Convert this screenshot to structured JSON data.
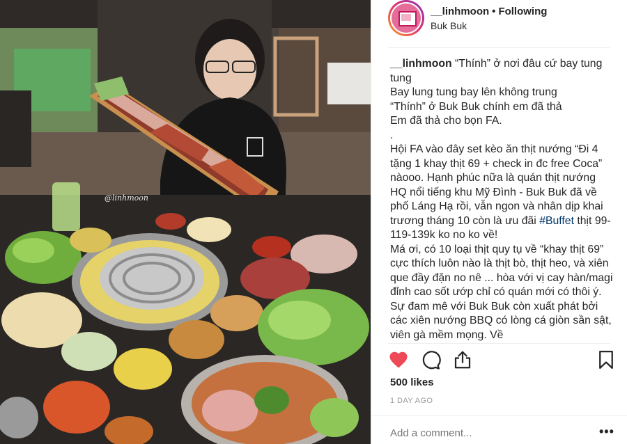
{
  "photo": {
    "alt": "Person seated behind a long wooden board of grilled meats and a table of BBQ side dishes",
    "watermark": "@linhmoon"
  },
  "header": {
    "username": "__linhmoon",
    "separator": "•",
    "follow_status": "Following",
    "location": "Buk Buk"
  },
  "caption": {
    "username": "__linhmoon",
    "lines": [
      "“Thính” ở nơi đâu cứ bay tung tung",
      "Bay lung tung bay lên không trung",
      "“Thính” ở Buk Buk chính em đã thả",
      "Em đã thả cho bọn FA.",
      ".",
      "Hội FA vào đây set kèo ăn thịt nướng “Đi 4 tặng 1 khay thịt 69 + check in đc free Coca” nàooo. Hạnh phúc nữa là quán thịt nướng HQ nổi tiếng khu Mỹ Đình - Buk Buk đã về phố Láng Hạ rồi, vẫn ngon và nhân dịp khai trương tháng 10 còn là ưu đãi"
    ],
    "hashtag": "#Buffet",
    "after_tag": " thịt 99-119-139k ko no ko về!",
    "paragraph2": "Má ơi, có 10 loại thịt quy tụ về “khay thịt 69” cực thích luôn nào là thịt bò, thịt heo, và xiên que đầy đặn no nê ... hòa với vị cay hàn/magi đỉnh cao sốt ướp chỉ có quán mới có thôi ý. Sự đam mê với Buk Buk còn xuất phát bởi các xiên nướng BBQ có lòng cá giòn sần sật, viên gà mềm mọng. Về"
  },
  "actions": {
    "like_icon": "heart-filled-icon",
    "comment_icon": "comment-icon",
    "share_icon": "share-icon",
    "save_icon": "bookmark-icon",
    "like_color": "#ed4956"
  },
  "likes": "500 likes",
  "time": "1 DAY AGO",
  "comment_box": {
    "placeholder": "Add a comment...",
    "more_label": "•••"
  }
}
